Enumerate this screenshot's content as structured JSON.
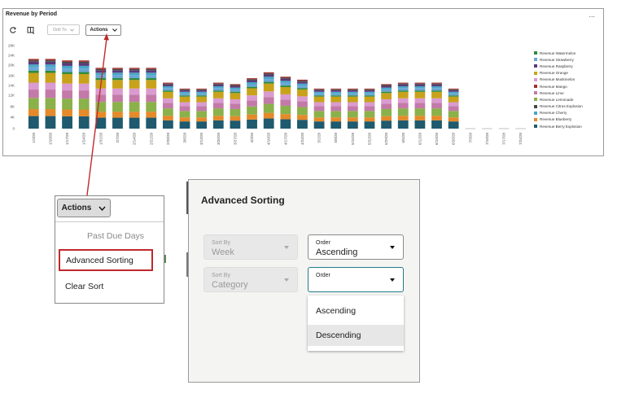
{
  "chart_panel": {
    "title": "Revenue by Period",
    "more_label": "...",
    "drill_to_label": "Drill To",
    "actions_label": "Actions"
  },
  "chart_data": {
    "type": "bar",
    "stacked": true,
    "ylim": [
      0,
      28000
    ],
    "y_ticks": [
      "28K",
      "24K",
      "20K",
      "16K",
      "14K",
      "12K",
      "8K",
      "4K",
      "0"
    ],
    "y_tick_values": [
      28000,
      24000,
      20000,
      16000,
      14000,
      12000,
      8000,
      4000,
      0
    ],
    "categories": [
      "1/3/28",
      "1/10/28",
      "1/17/28",
      "1/24/28",
      "1/31/28",
      "2/7/28",
      "2/14/28",
      "2/21/28",
      "2/28/28",
      "3/6/28",
      "3/13/28",
      "3/20/28",
      "3/27/28",
      "4/3/28",
      "4/10/28",
      "4/17/28",
      "4/24/28",
      "5/1/28",
      "5/8/28",
      "5/15/28",
      "5/22/28",
      "5/29/28",
      "6/5/28",
      "6/12/28",
      "6/19/28",
      "6/26/28",
      "7/3/28",
      "7/10/28",
      "7/17/28",
      "7/24/28"
    ],
    "totals": [
      23500,
      23500,
      23000,
      23000,
      20500,
      20500,
      20500,
      20500,
      15500,
      13500,
      13500,
      15500,
      15000,
      17000,
      19000,
      17500,
      16500,
      13500,
      13500,
      13500,
      13500,
      15000,
      15500,
      15500,
      15500,
      13500,
      0,
      0,
      0,
      0
    ],
    "series": [
      {
        "name": "Revenue Watermelon",
        "color": "#2e8b3d"
      },
      {
        "name": "Revenue Strawberry",
        "color": "#6aa6d6"
      },
      {
        "name": "Revenue Raspberry",
        "color": "#5b3a7a"
      },
      {
        "name": "Revenue Orange",
        "color": "#c8a21a"
      },
      {
        "name": "Revenue Muskmelon",
        "color": "#d99bd0"
      },
      {
        "name": "Revenue Mango",
        "color": "#a0322d"
      },
      {
        "name": "Revenue Lime",
        "color": "#c37aa8"
      },
      {
        "name": "Revenue Lemonade",
        "color": "#8ab14a"
      },
      {
        "name": "Revenue Citrus Explosion",
        "color": "#474747"
      },
      {
        "name": "Revenue Cherry",
        "color": "#47a7c8"
      },
      {
        "name": "Revenue Blueberry",
        "color": "#e58a2a"
      },
      {
        "name": "Revenue Berry Explosion",
        "color": "#1f5a6e"
      }
    ]
  },
  "actions_menu": {
    "button_label": "Actions",
    "items": [
      "Past Due Days",
      "Advanced Sorting",
      "Clear Sort"
    ]
  },
  "advanced_sorting": {
    "title": "Advanced Sorting",
    "sort_by_label": "Sort By",
    "sort_by_1_value": "Week",
    "order_label": "Order",
    "order_1_value": "Ascending",
    "sort_by_2_value": "Category",
    "order_2_value": "",
    "options": [
      "Ascending",
      "Descending"
    ]
  },
  "colors": {
    "highlight_border": "#c0292c",
    "focus_border": "#227c88",
    "arrow": "#c0292c"
  }
}
